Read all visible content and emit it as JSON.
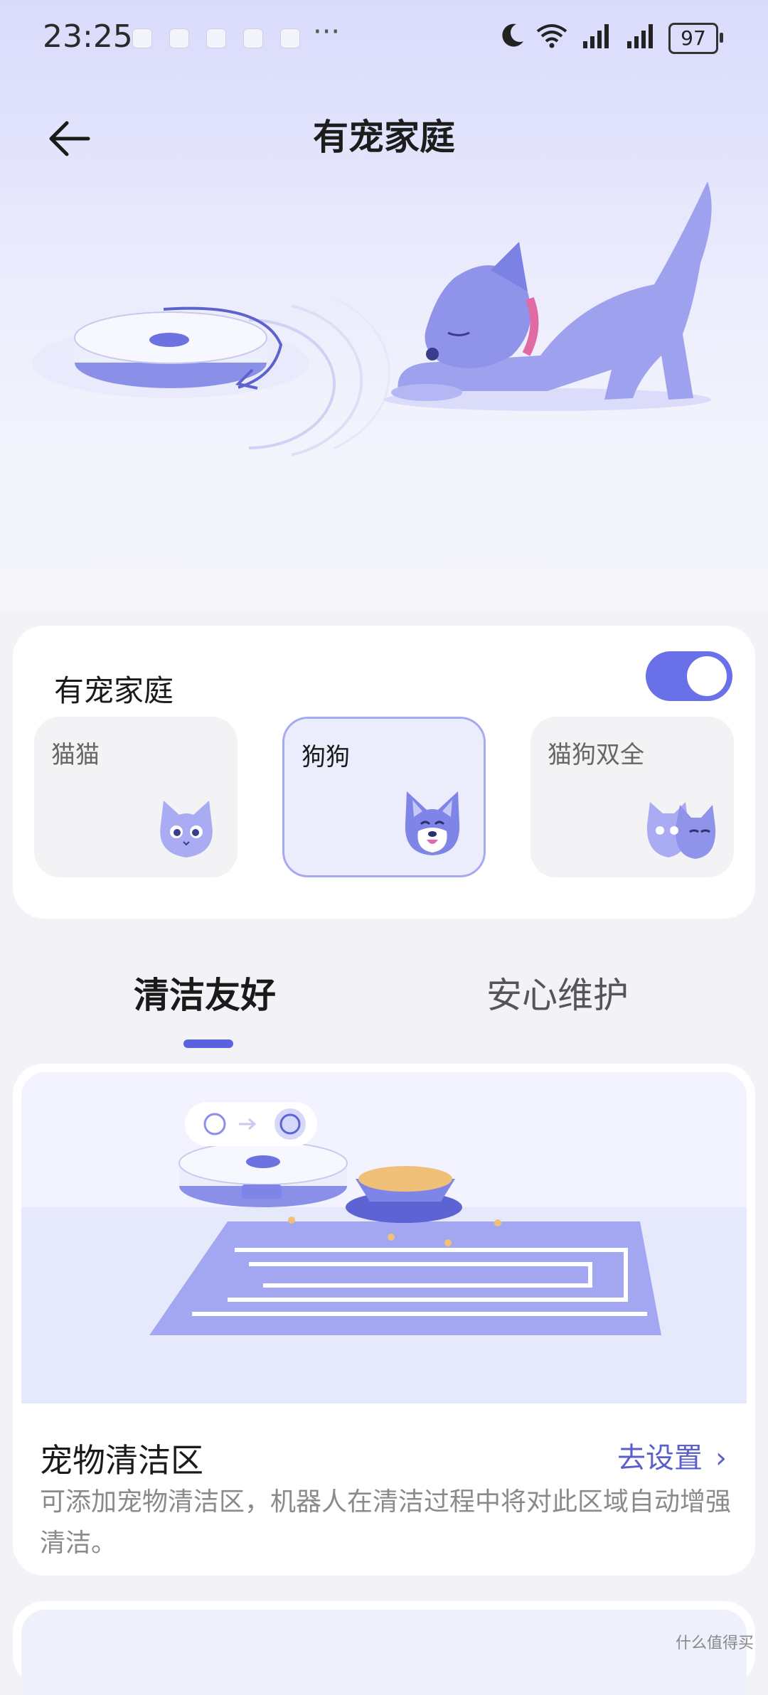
{
  "status_bar": {
    "time": "23:25",
    "more": "···",
    "battery": "97"
  },
  "header": {
    "title": "有宠家庭"
  },
  "pet_section": {
    "label": "有宠家庭",
    "toggle_on": true,
    "options": [
      {
        "label": "猫猫",
        "selected": false
      },
      {
        "label": "狗狗",
        "selected": true
      },
      {
        "label": "猫狗双全",
        "selected": false
      }
    ]
  },
  "tabs": [
    {
      "label": "清洁友好",
      "active": true
    },
    {
      "label": "安心维护",
      "active": false
    }
  ],
  "feature": {
    "title": "宠物清洁区",
    "link": "去设置",
    "description": "可添加宠物清洁区，机器人在清洁过程中将对此区域自动增强清洁。"
  },
  "watermark": "什么值得买",
  "colors": {
    "accent": "#6a70e8",
    "link": "#5b60c8",
    "hero_top": "#d9dbfb"
  }
}
